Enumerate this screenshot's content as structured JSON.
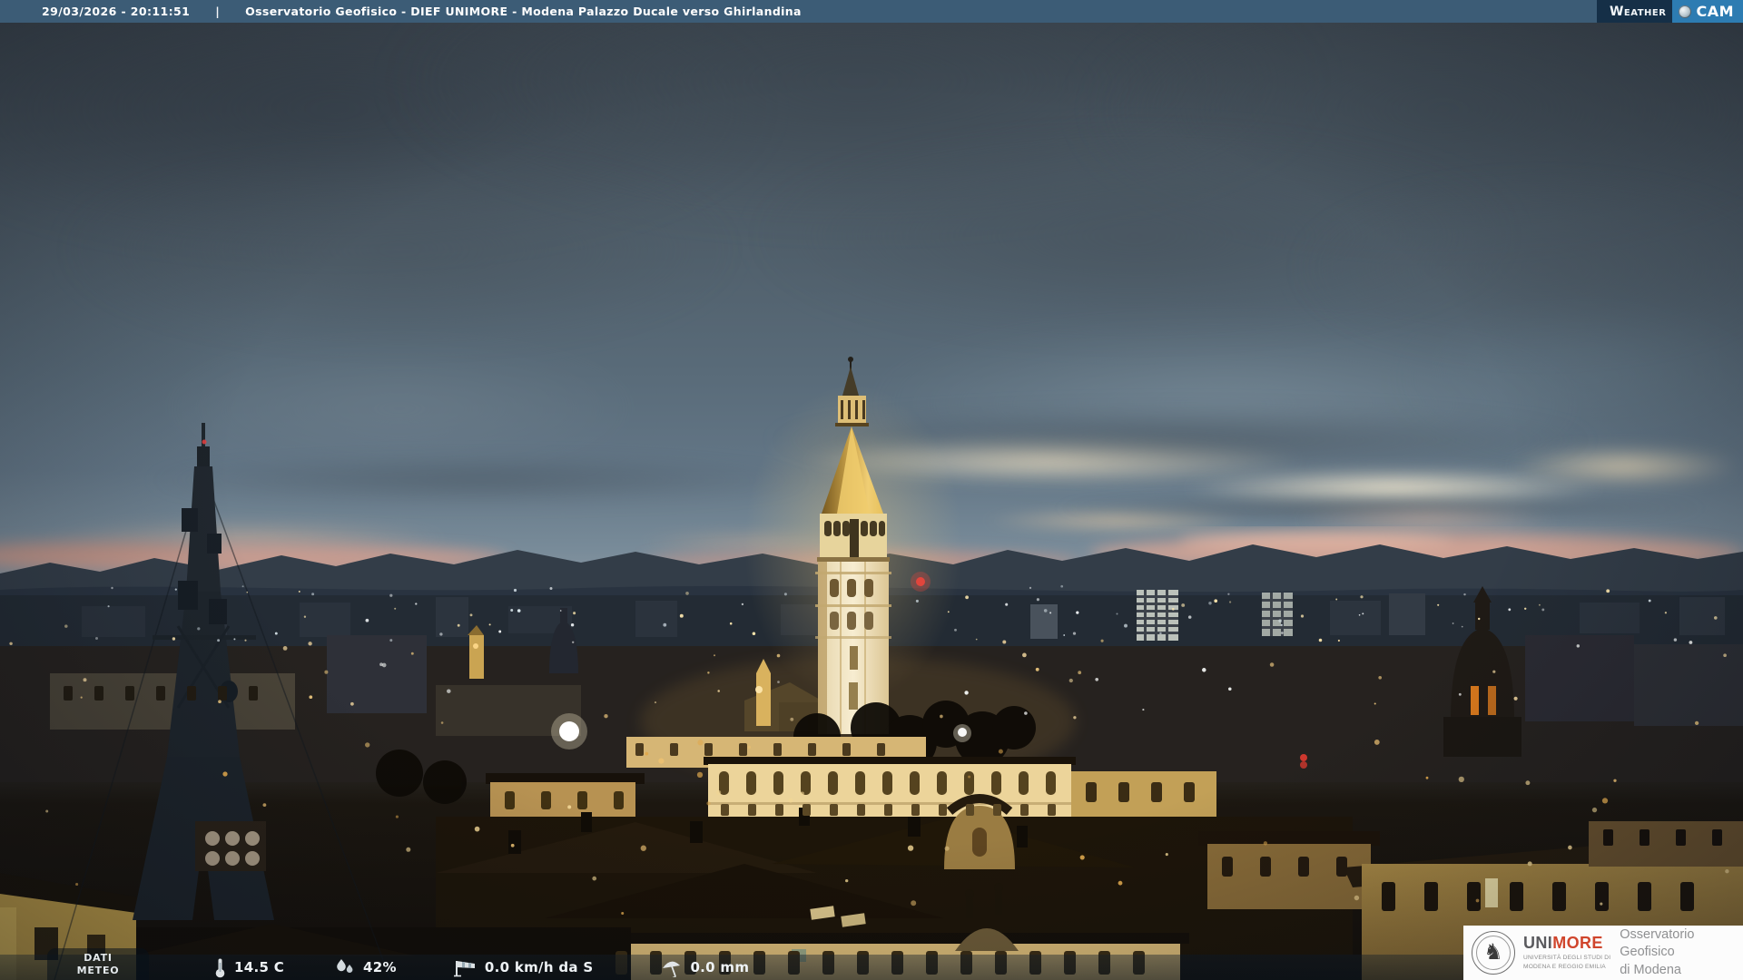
{
  "header": {
    "datetime": "29/03/2026 - 20:11:51",
    "separator": "|",
    "title": "Osservatorio Geofisico - DIEF UNIMORE - Modena Palazzo Ducale verso Ghirlandina",
    "logo": {
      "word1": "Weather",
      "word2": "CAM"
    }
  },
  "footer": {
    "tab_line1": "DATI",
    "tab_line2": "METEO",
    "readings": [
      {
        "icon": "thermometer-icon",
        "value": "14.5 C"
      },
      {
        "icon": "humidity-icon",
        "value": "42%"
      },
      {
        "icon": "wind-icon",
        "value": "0.0 km/h da S"
      },
      {
        "icon": "rain-icon",
        "value": "0.0 mm"
      }
    ]
  },
  "branding": {
    "uni": "UNI",
    "more": "MORE",
    "subtitle_line1": "UNIVERSITÀ DEGLI STUDI DI",
    "subtitle_line2": "MODENA E REGGIO EMILIA",
    "org_line1": "Osservatorio Geofisico",
    "org_line2": "di Modena"
  },
  "scene": {
    "description": "Dusk webcam panorama of Modena: illuminated Ghirlandina tower, lattice antenna mast, rooftops and sunset over the Apennines",
    "colors": {
      "topbar": "#3c5c76",
      "logo_navy": "#152f47",
      "logo_accent": "#2d7cb2",
      "tower_gold": "#f0ce74",
      "sunset_pink": "#d2a091",
      "sky_dark": "#49555f"
    }
  }
}
